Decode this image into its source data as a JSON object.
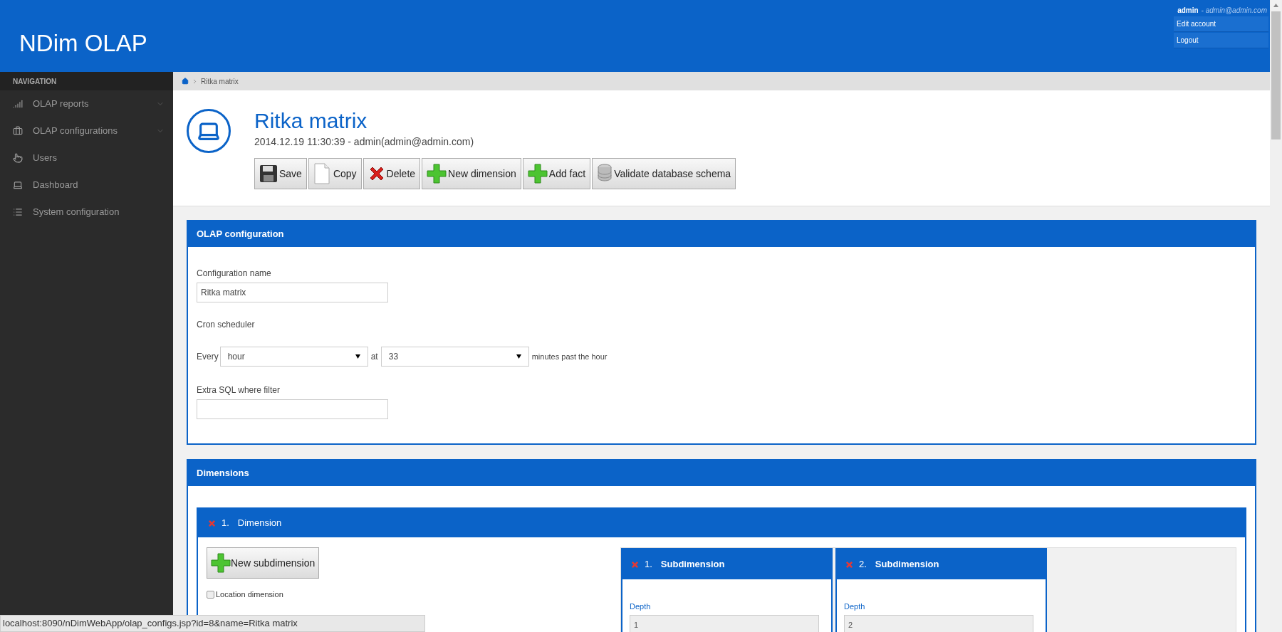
{
  "header": {
    "title": "NDim OLAP",
    "user": {
      "name": "admin",
      "email": "- admin@admin.com",
      "links": [
        "Edit account",
        "Logout"
      ]
    }
  },
  "sidebar": {
    "heading": "NAVIGATION",
    "items": [
      {
        "label": "OLAP reports",
        "kind": "reports",
        "has_submenu": true
      },
      {
        "label": "OLAP configurations",
        "kind": "configurations",
        "has_submenu": true
      },
      {
        "label": "Users",
        "kind": "users",
        "has_submenu": false
      },
      {
        "label": "Dashboard",
        "kind": "dashboard",
        "has_submenu": false
      },
      {
        "label": "System configuration",
        "kind": "system",
        "has_submenu": false
      }
    ]
  },
  "breadcrumb": [
    "Ritka matrix"
  ],
  "page": {
    "title": "Ritka matrix",
    "subtitle": "2014.12.19 11:30:39 - admin(admin@admin.com)"
  },
  "toolbar": [
    {
      "label": "Save",
      "kind": "save"
    },
    {
      "label": "Copy",
      "kind": "copy"
    },
    {
      "label": "Delete",
      "kind": "delete"
    },
    {
      "label": "New dimension",
      "kind": "add"
    },
    {
      "label": "Add fact",
      "kind": "add"
    },
    {
      "label": "Validate database schema",
      "kind": "database"
    }
  ],
  "olap_configuration": {
    "title": "OLAP configuration",
    "config_name": {
      "label": "Configuration name",
      "value": "Ritka matrix"
    },
    "cron": {
      "label": "Cron scheduler",
      "every_label": "Every",
      "every_value": "hour",
      "at_label": "at",
      "at_value": "33",
      "suffix": "minutes past the hour"
    },
    "extra_sql": {
      "label": "Extra SQL where filter"
    }
  },
  "dimensions": {
    "title": "Dimensions",
    "items": [
      {
        "number": "1.",
        "title": "Dimension",
        "new_subdimension": "New subdimension",
        "location": {
          "label": "Location dimension",
          "checked": false
        },
        "subdimensions": [
          {
            "number": "1.",
            "title": "Subdimension",
            "depth_label": "Depth",
            "depth": "1"
          },
          {
            "number": "2.",
            "title": "Subdimension",
            "depth_label": "Depth",
            "depth": "2"
          }
        ]
      }
    ]
  },
  "status_url": "localhost:8090/nDimWebApp/olap_configs.jsp?id=8&name=Ritka matrix"
}
